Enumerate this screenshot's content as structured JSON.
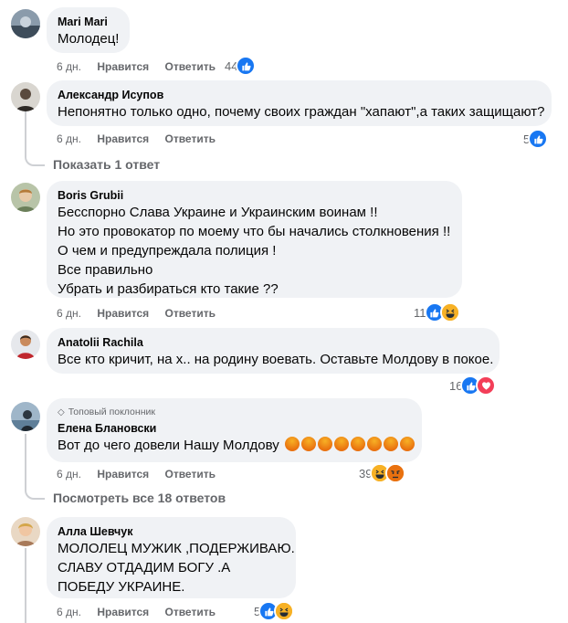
{
  "comments": [
    {
      "author": "Mari Mari",
      "lines": [
        "Молодец!"
      ],
      "time": "6 дн.",
      "like_label": "Нравится",
      "reply_label": "Ответить",
      "reaction_count": "44",
      "reactions": [
        "like"
      ]
    },
    {
      "author": "Александр Исупов",
      "lines": [
        "Непонятно только одно, почему своих граждан \"хапают\",а таких защищают?"
      ],
      "time": "6 дн.",
      "like_label": "Нравится",
      "reply_label": "Ответить",
      "reaction_count": "5",
      "reactions": [
        "like"
      ],
      "replies_link": "Показать 1 ответ"
    },
    {
      "author": "Boris Grubii",
      "lines": [
        "Бесспорно Слава Украине и Украинским воинам !!",
        "Но это провокатор по моему что бы начались столкновения !!",
        "О чем и предупреждала полиция !",
        "Все правильно",
        "Убрать и разбираться кто такие ??"
      ],
      "time": "6 дн.",
      "like_label": "Нравится",
      "reply_label": "Ответить",
      "reaction_count": "11",
      "reactions": [
        "like",
        "haha"
      ]
    },
    {
      "author": "Anatolii Rachila",
      "lines": [
        "Все кто кричит, на х.. на родину воевать. Оставьте Молдову в покое."
      ],
      "time": "6 дн.",
      "like_label": "Нравится",
      "reply_label": "Ответить",
      "reaction_count": "16",
      "reactions": [
        "like",
        "love"
      ]
    },
    {
      "badge": "Топовый поклонник",
      "author": "Елена Блановски",
      "lines": [
        "Вот до чего довели Нашу Молдову"
      ],
      "emoji_count": 8,
      "emoji_name": "angry-face",
      "time": "6 дн.",
      "like_label": "Нравится",
      "reply_label": "Ответить",
      "reaction_count": "39",
      "reactions": [
        "haha",
        "angry"
      ],
      "replies_link": "Посмотреть все 18 ответов"
    },
    {
      "author": "Алла Шевчук",
      "lines": [
        "МОЛОЛЕЦ МУЖИК ,ПОДЕРЖИВАЮ.",
        "СЛАВУ ОТДАДИМ БОГУ .А",
        "ПОБЕДУ УКРАИНЕ."
      ],
      "time": "6 дн.",
      "like_label": "Нравится",
      "reply_label": "Ответить",
      "reaction_count": "5",
      "reactions": [
        "like",
        "haha"
      ]
    }
  ],
  "colors": {
    "bubble": "#f0f2f5",
    "meta_text": "#65676b",
    "like": "#1877f2",
    "love": "#f33e58",
    "haha": "#f7b125",
    "angry": "#e9710f"
  }
}
